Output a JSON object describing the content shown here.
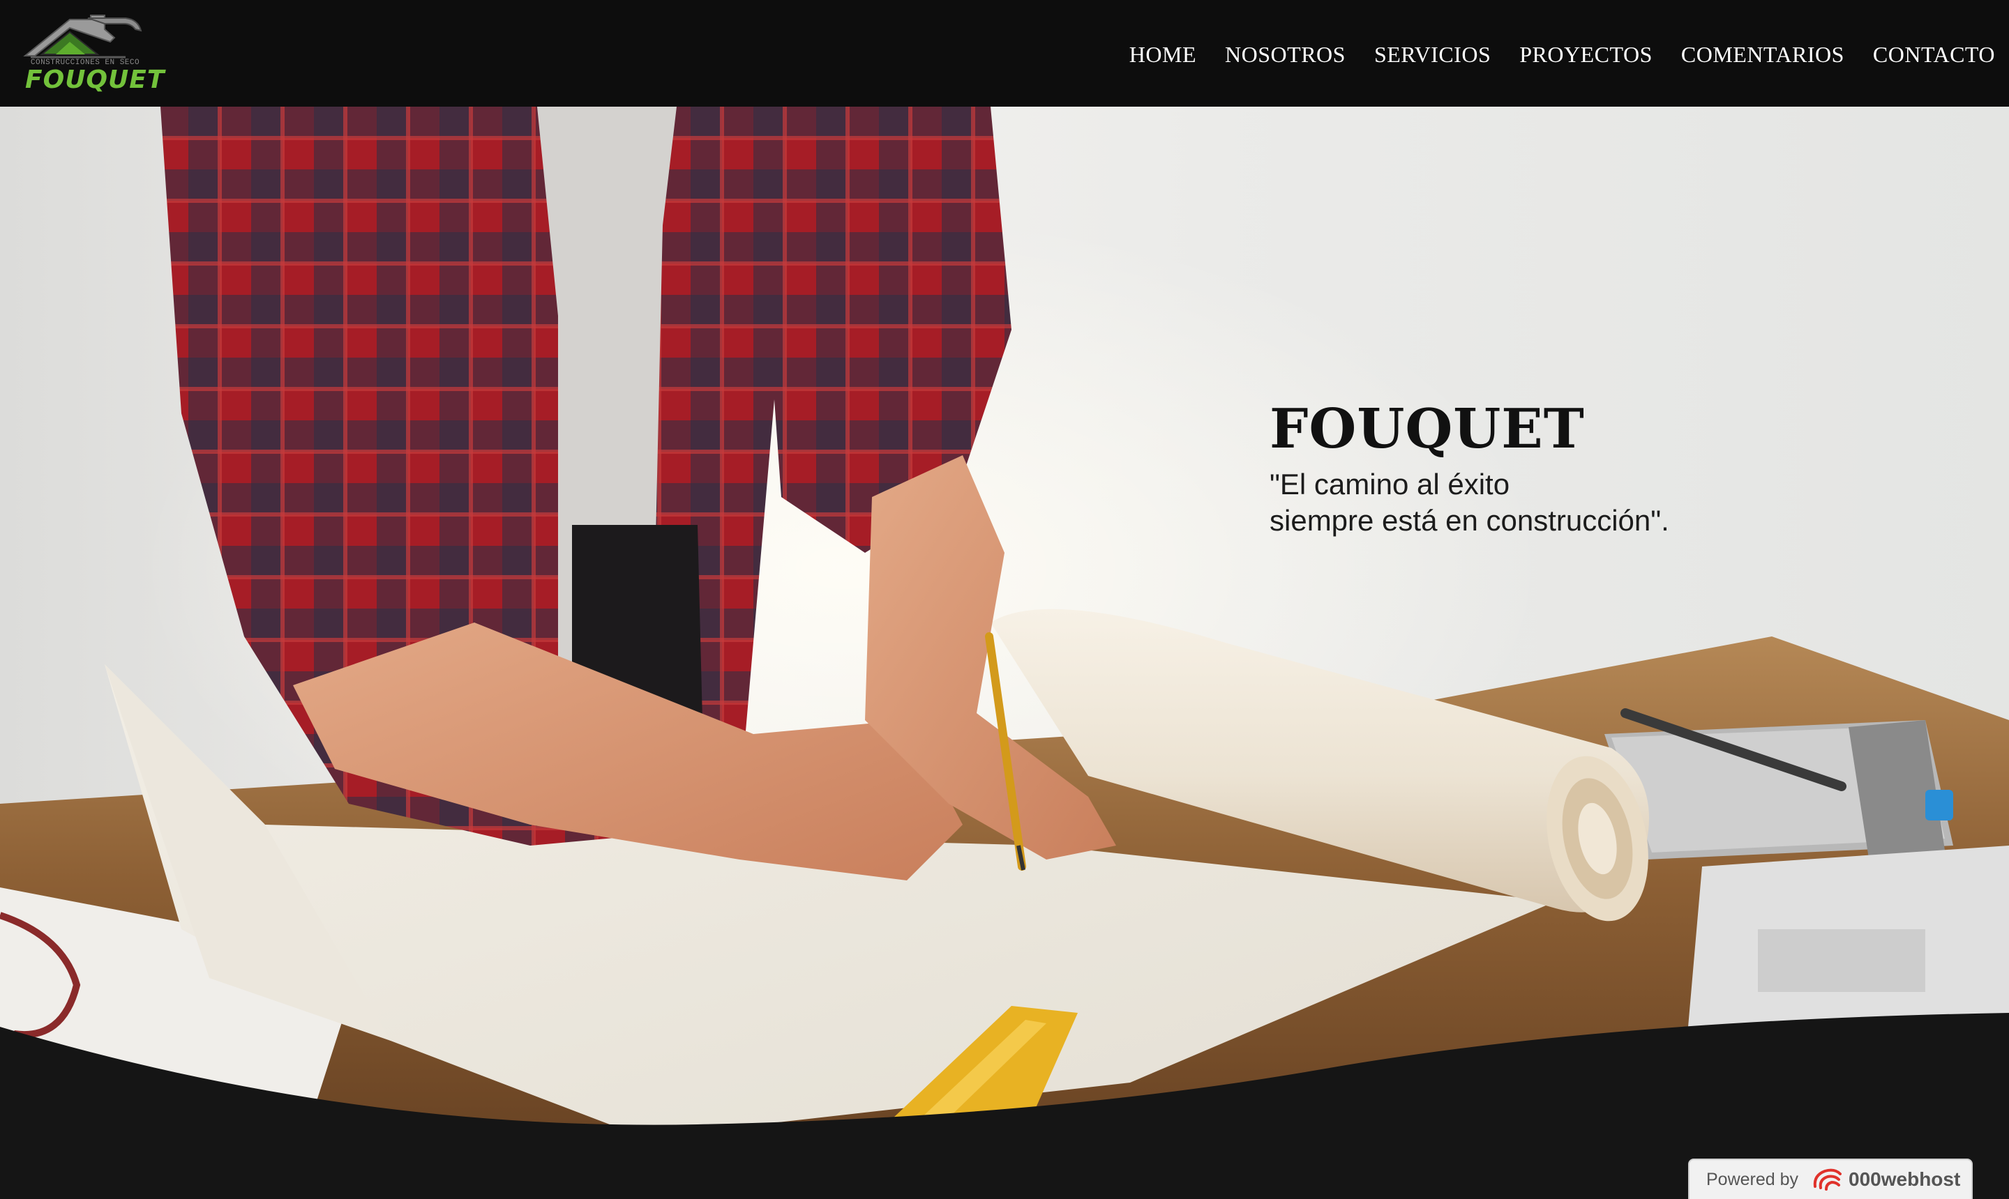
{
  "brand": {
    "logo_subtitle": "CONSTRUCCIONES EN SECO",
    "logo_name": "FOUQUET"
  },
  "nav": {
    "items": [
      {
        "label": "HOME"
      },
      {
        "label": "NOSOTROS"
      },
      {
        "label": "SERVICIOS"
      },
      {
        "label": "PROYECTOS"
      },
      {
        "label": "COMENTARIOS"
      },
      {
        "label": "CONTACTO"
      }
    ]
  },
  "hero": {
    "title": "FOUQUET",
    "quote_line1": "\"El camino al éxito",
    "quote_line2": "siempre está en construcción\"."
  },
  "badge": {
    "powered_by": "Powered by",
    "brand": "000webhost"
  },
  "colors": {
    "header_bg": "#0d0d0d",
    "accent_green": "#73c23b",
    "footer_bg": "#151515"
  }
}
